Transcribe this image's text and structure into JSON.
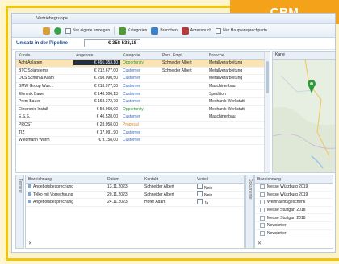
{
  "badge": "CRM",
  "window": {
    "title": "Vertriebsgruppe"
  },
  "toolbar": {
    "own_only": "Nur eigene anzeigen",
    "categories": "Kategorien",
    "industries": "Branchen",
    "address_book": "Adressbuch",
    "main_partners": "Nur Hauptansprechpartn"
  },
  "pipeline": {
    "label": "Umsatz in der Pipeline",
    "value": "€ 358 538,18"
  },
  "grid": {
    "columns": [
      "Kunde",
      "Angebote",
      "Kategorie",
      "Pers. Empf.",
      "Branche"
    ],
    "rows": [
      {
        "kunde": "Acht Anlagen",
        "angebote": "€ 491.353,10",
        "kategorie": "Opportunity",
        "empf": "Schneider Albert",
        "branche": "Metallverarbeitung",
        "cat": "green",
        "selected": true
      },
      {
        "kunde": "BTC Solarsterns",
        "angebote": "€ 212.677,00",
        "kategorie": "Customer",
        "empf": "Schneider Albert",
        "branche": "Metallverarbeitung",
        "cat": "blue"
      },
      {
        "kunde": "DKS Schuh & Kram",
        "angebote": "€ 298.090,50",
        "kategorie": "Customer",
        "empf": "",
        "branche": "Metallverarbeitung",
        "cat": "blue"
      },
      {
        "kunde": "BMW Group Wue...",
        "angebote": "€ 218.977,30",
        "kategorie": "Customer",
        "empf": "",
        "branche": "Maschinenbau",
        "cat": "blue"
      },
      {
        "kunde": "Elomnik Bauer",
        "angebote": "€ 148.506,13",
        "kategorie": "Customer",
        "empf": "",
        "branche": "Spedition",
        "cat": "blue"
      },
      {
        "kunde": "Prem Bauer",
        "angebote": "€ 168.372,70",
        "kategorie": "Customer",
        "empf": "",
        "branche": "Mechanik Werkstatt",
        "cat": "blue"
      },
      {
        "kunde": "Electronic Install",
        "angebote": "€ 59.960,00",
        "kategorie": "Opportunity",
        "empf": "",
        "branche": "Mechanik Werkstatt",
        "cat": "green"
      },
      {
        "kunde": "E.S.S.",
        "angebote": "€ 40.528,00",
        "kategorie": "Customer",
        "empf": "",
        "branche": "Maschinenbau",
        "cat": "blue"
      },
      {
        "kunde": "PROST",
        "angebote": "€ 28.058,00",
        "kategorie": "Proposal",
        "empf": "",
        "branche": "",
        "cat": "prop"
      },
      {
        "kunde": "TIZ",
        "angebote": "€ 17.091,90",
        "kategorie": "Customer",
        "empf": "",
        "branche": "",
        "cat": "blue"
      },
      {
        "kunde": "Wiedmann Wurm",
        "angebote": "€ 9.158,00",
        "kategorie": "Customer",
        "empf": "",
        "branche": "",
        "cat": "blue"
      }
    ]
  },
  "map": {
    "header": "Karte"
  },
  "lower_tabs": {
    "left": "Termine",
    "right": "Dokumente"
  },
  "activities": {
    "columns": [
      "Bezeichnung",
      "Datum",
      "Kontakt",
      "Verteil"
    ],
    "rows": [
      {
        "bez": "Angebotsbesprechung",
        "datum": "13.11.2023",
        "kontakt": "Schneider Albert",
        "verteil": "Nein"
      },
      {
        "bez": "Telko mit Vorrechnung",
        "datum": "20.11.2023",
        "kontakt": "Schneider Albert",
        "verteil": "Nein"
      },
      {
        "bez": "Angebotsbesprechung",
        "datum": "24.11.2023",
        "kontakt": "Höfer Adam",
        "verteil": "Ja"
      }
    ]
  },
  "documents": {
    "header": "Bezeichnung",
    "items": [
      "Messe Würzburg 2019",
      "Messe Würzburg 2019",
      "Weihnachtsgeschenk",
      "Messe Stuttgart 2018",
      "Messe Stuttgart 2018",
      "Newsletter",
      "Newsletter"
    ]
  },
  "colors": {
    "accent": "#f4a21a",
    "frame": "#f1c40f",
    "selection": "#fbe4b3"
  }
}
